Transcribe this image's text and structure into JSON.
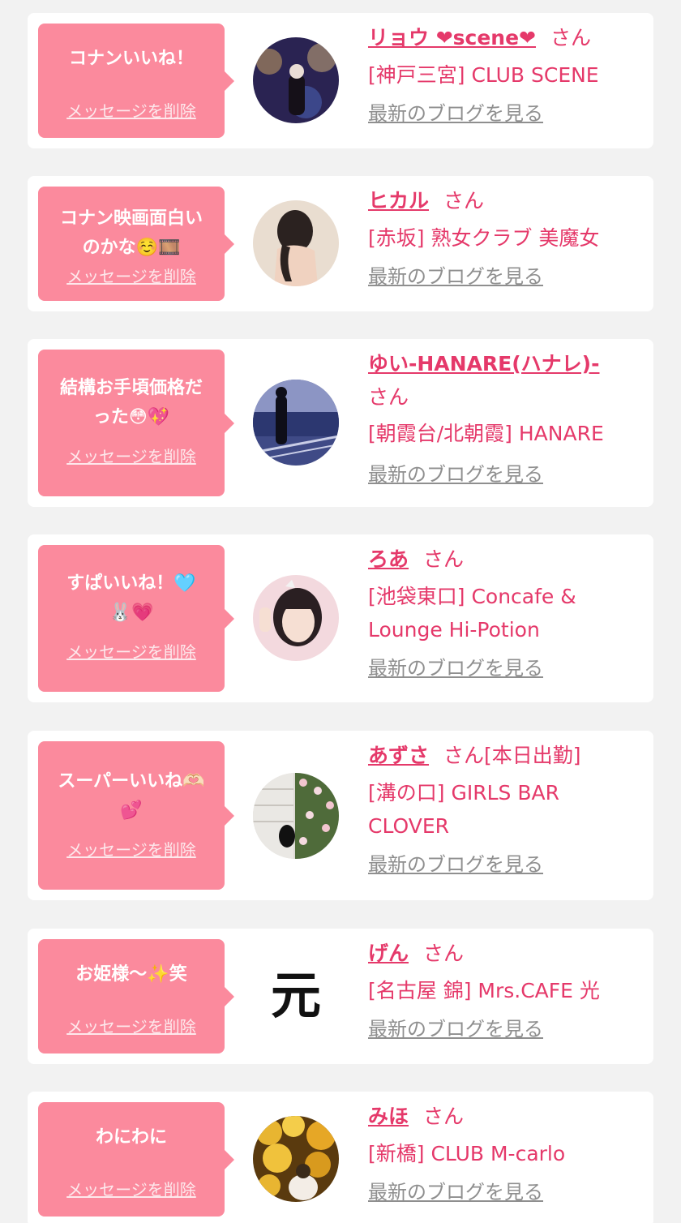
{
  "ui": {
    "san": "さん",
    "delete_label": "メッセージを削除",
    "blog_label": "最新のブログを見る"
  },
  "items": [
    {
      "message": "コナンいいね！",
      "name": "リョウ ❤scene❤",
      "shop": "[神戸三宮] CLUB SCENE",
      "avatar_icon": "avatar-night-lights"
    },
    {
      "message": "コナン映画面白い\nのかな☺️🎞️",
      "name": "ヒカル",
      "shop": "[赤坂] 熟女クラブ 美魔女",
      "avatar_icon": "avatar-portrait"
    },
    {
      "message": "結構お手頃価格だ\nった😳💖",
      "name": "ゆい-HANARE(ハナレ)-",
      "shop": "[朝霞台/北朝霞] HANARE",
      "avatar_icon": "avatar-seaside"
    },
    {
      "message": "すぱいいね！🩵\n🐰💗",
      "name": "ろあ",
      "shop_lines": [
        "[池袋東口] Concafe &",
        "Lounge Hi-Potion"
      ],
      "avatar_icon": "avatar-selfie"
    },
    {
      "message": "スーパーいいね🫶🏻\n💕",
      "name": "あずさ",
      "name_suffix": "[本日出勤]",
      "shop_lines": [
        "[溝の口] GIRLS BAR",
        "CLOVER"
      ],
      "avatar_icon": "avatar-flowers"
    },
    {
      "message": "お姫様〜✨笑",
      "name": "げん",
      "shop": "[名古屋 錦] Mrs.CAFE 光",
      "avatar_icon": "avatar-kanji-logo",
      "avatar_text": "元"
    },
    {
      "message": "わにわに",
      "name": "みほ",
      "shop": "[新橋] CLUB M-carlo",
      "avatar_icon": "avatar-gold-lights"
    }
  ]
}
